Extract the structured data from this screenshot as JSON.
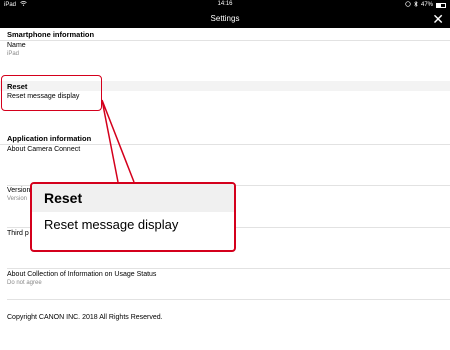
{
  "statusbar": {
    "device": "iPad",
    "time": "14:16",
    "battery": "47%"
  },
  "navbar": {
    "title": "Settings",
    "close_glyph": "✕"
  },
  "sections": {
    "smartphone": {
      "header": "Smartphone information",
      "name_label": "Name",
      "name_value": "iPad"
    },
    "reset": {
      "header": "Reset",
      "item": "Reset message display"
    },
    "application": {
      "header": "Application information",
      "about": "About Camera Connect",
      "version_label": "Version",
      "version_sub": "Version",
      "third_party": "Third p",
      "usage_label": "About Collection of Information on Usage Status",
      "usage_value": "Do not agree",
      "copyright": "Copyright CANON INC. 2018 All Rights Reserved."
    }
  },
  "callout": {
    "header": "Reset",
    "item": "Reset message display",
    "color": "#d4001c"
  }
}
